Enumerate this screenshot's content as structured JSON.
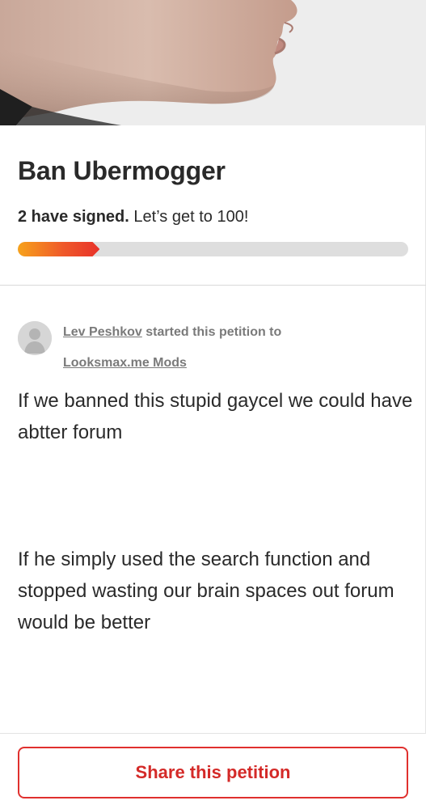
{
  "hero": {
    "alt": "Photo of a man's chin and lips in profile"
  },
  "petition": {
    "title": "Ban Ubermogger",
    "signed_count_text": "2 have signed.",
    "goal_text": "Let’s get to 100!",
    "progress_fraction": 0.21
  },
  "starter": {
    "author": "Lev Peshkov",
    "middle_text": "started this petition to",
    "target": "Looksmax.me Mods"
  },
  "body": {
    "paragraphs": [
      "If we banned this stupid gaycel we could have abtter forum",
      "If he simply used the search function and stopped wasting our brain spaces out forum would be better"
    ]
  },
  "footer": {
    "share_label": "Share this petition"
  },
  "colors": {
    "accent": "#e0302e",
    "progress_start": "#f7a21b",
    "progress_end": "#e8322a",
    "progress_track": "#dedede"
  }
}
